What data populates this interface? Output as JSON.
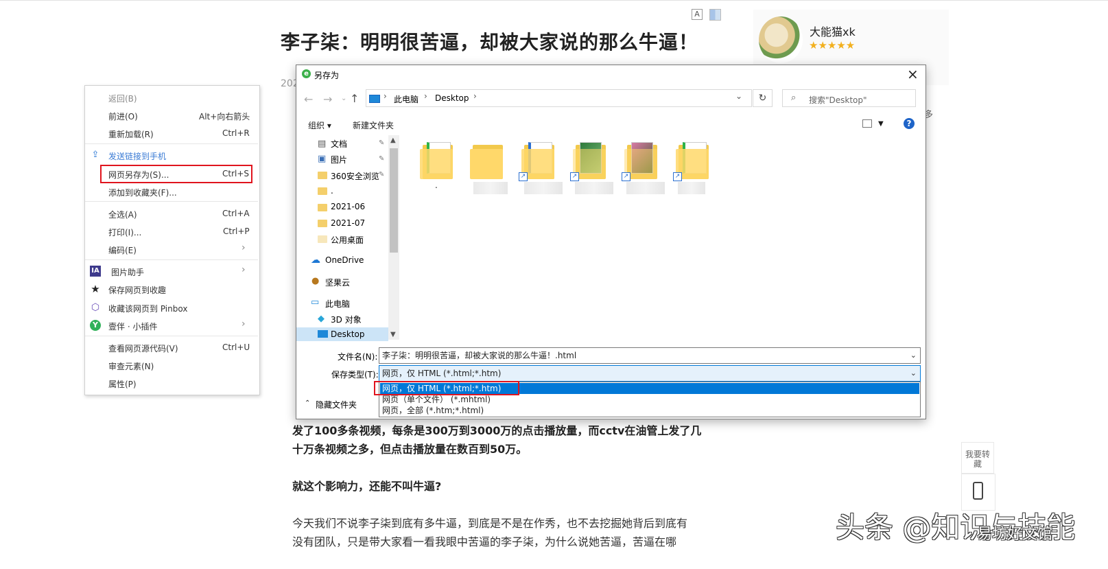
{
  "article": {
    "title": "李子柒：明明很苦逼，却被大家说的那么牛逼！",
    "date": "202",
    "font_ctrl": "A",
    "para1_line1": "发了100多条视频，每条是300万到3000万的点击播放量，而cctv在油管上发了几",
    "para1_line2": "十万条视频之多，但点击播放量在数百到50万。",
    "para2": "就这个影响力，还能不叫牛逼?",
    "para3_line1": "今天我们不说李子柒到底有多牛逼，到底是不是在作秀，也不去挖掘她背后到底有",
    "para3_line2": "没有团队，只是带大家看一看我眼中苦逼的李子柒，为什么说她苦逼，苦逼在哪"
  },
  "author": {
    "name": "大能猫xk",
    "stars": "★★★★★",
    "read_more": "多"
  },
  "side_tools": {
    "favorite_label": "我要转藏",
    "phone_icon": "mobile-phone-icon"
  },
  "watermark": {
    "main": "头条 @知识与技能",
    "sub": "易坊好文馆"
  },
  "context_menu": {
    "items": [
      {
        "label": "返回(B)",
        "shortcut": ""
      },
      {
        "label": "前进(O)",
        "shortcut": "Alt+向右箭头"
      },
      {
        "label": "重新加载(R)",
        "shortcut": "Ctrl+R"
      },
      {
        "label": "发送链接到手机",
        "shortcut": ""
      },
      {
        "label": "网页另存为(S)...",
        "shortcut": "Ctrl+S"
      },
      {
        "label": "添加到收藏夹(F)...",
        "shortcut": ""
      },
      {
        "label": "全选(A)",
        "shortcut": "Ctrl+A"
      },
      {
        "label": "打印(I)...",
        "shortcut": "Ctrl+P"
      },
      {
        "label": "编码(E)",
        "shortcut": ""
      },
      {
        "label": "图片助手",
        "shortcut": ""
      },
      {
        "label": "保存网页到收趣",
        "shortcut": ""
      },
      {
        "label": "收藏该网页到 Pinbox",
        "shortcut": ""
      },
      {
        "label": "壹伴 · 小插件",
        "shortcut": ""
      },
      {
        "label": "查看网页源代码(V)",
        "shortcut": "Ctrl+U"
      },
      {
        "label": "审查元素(N)",
        "shortcut": ""
      },
      {
        "label": "属性(P)",
        "shortcut": ""
      }
    ]
  },
  "dialog": {
    "title": "另存为",
    "path": [
      "此电脑",
      "Desktop"
    ],
    "search_placeholder": "搜索\"Desktop\"",
    "organize": "组织 ▾",
    "new_folder": "新建文件夹",
    "nav_items": [
      "文档",
      "图片",
      "360安全浏览",
      ".",
      "2021-06",
      "2021-07",
      "公用桌面",
      "OneDrive",
      "坚果云",
      "此电脑",
      "3D 对象",
      "Desktop"
    ],
    "first_file_label": ".",
    "filename_label": "文件名(N):",
    "filename_value": "李子柒：明明很苦逼，却被大家说的那么牛逼！.html",
    "filetype_label": "保存类型(T):",
    "filetype_value": "网页，仅 HTML (*.html;*.htm)",
    "filetype_options": [
      "网页，仅 HTML (*.html;*.htm)",
      "网页（单个文件） (*.mhtml)",
      "网页，全部 (*.htm;*.html)"
    ],
    "hide_folders": "隐藏文件夹"
  }
}
